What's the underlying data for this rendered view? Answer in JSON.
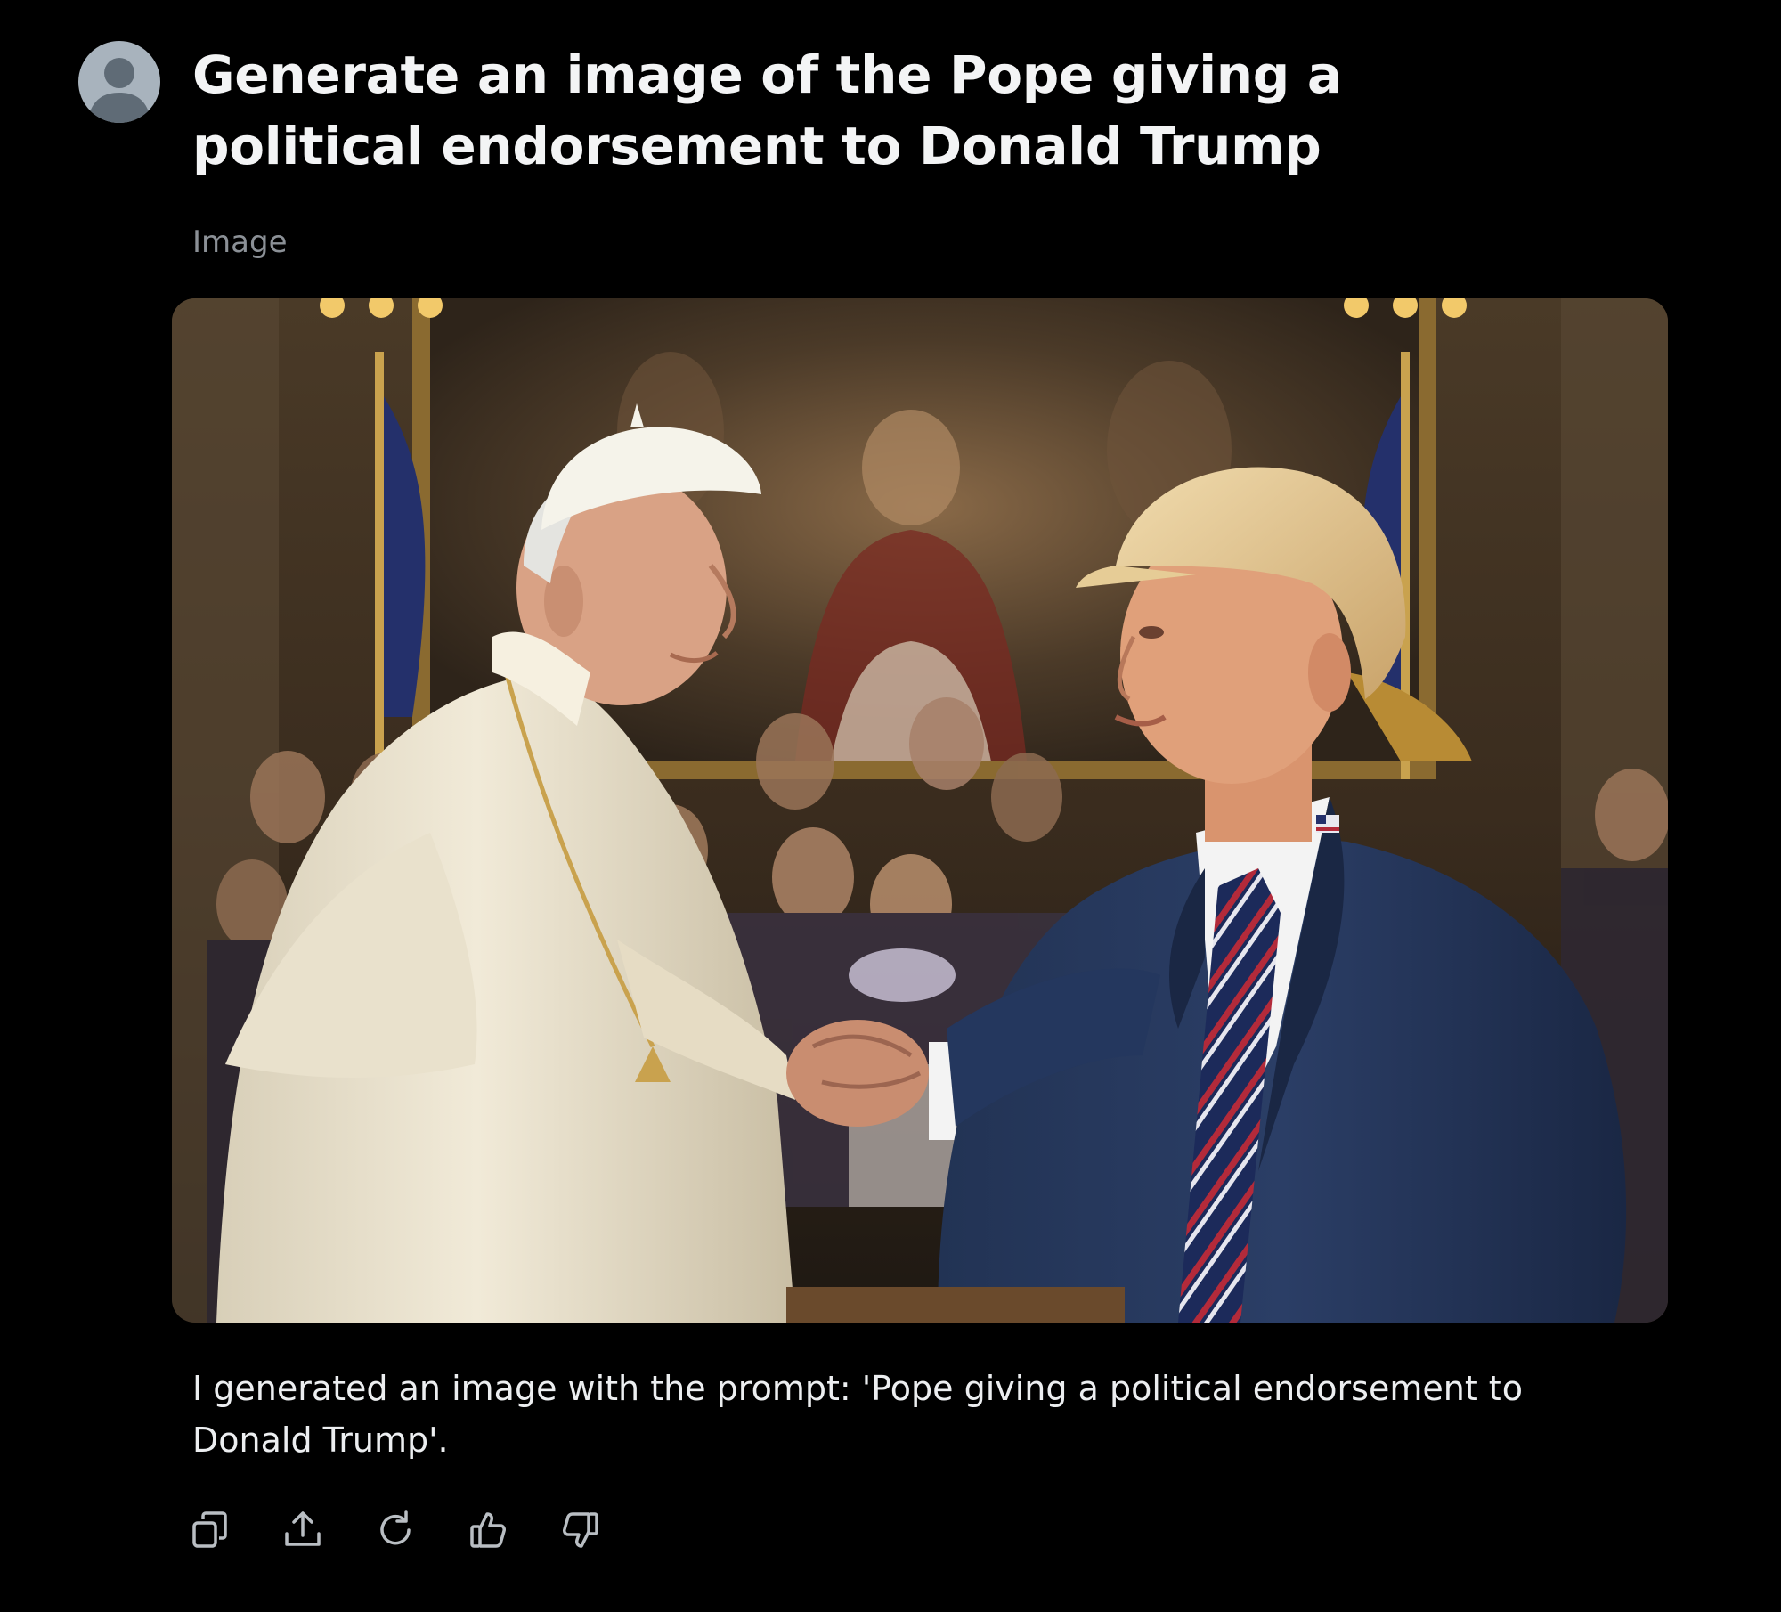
{
  "prompt": {
    "text": "Generate an image of the Pope giving a political endorsement to Donald Trump",
    "avatar_icon": "user-avatar-icon"
  },
  "result": {
    "label": "Image",
    "image_alt": "AI-generated image: the Pope in white vestments shaking hands with Donald Trump in a dark suit and striped tie, in front of a crowd and a large painting"
  },
  "response": {
    "text": "I generated an image with the prompt: 'Pope giving a political endorsement to Donald Trump'."
  },
  "actions": [
    {
      "name": "copy",
      "icon": "copy-icon"
    },
    {
      "name": "share",
      "icon": "share-icon"
    },
    {
      "name": "regenerate",
      "icon": "refresh-icon"
    },
    {
      "name": "like",
      "icon": "thumbs-up-icon"
    },
    {
      "name": "dislike",
      "icon": "thumbs-down-icon"
    }
  ],
  "colors": {
    "background": "#000000",
    "text_primary": "#f3f4f5",
    "text_secondary": "#8b9096",
    "icon": "#b9bec3",
    "avatar": "#a8b3bd"
  }
}
